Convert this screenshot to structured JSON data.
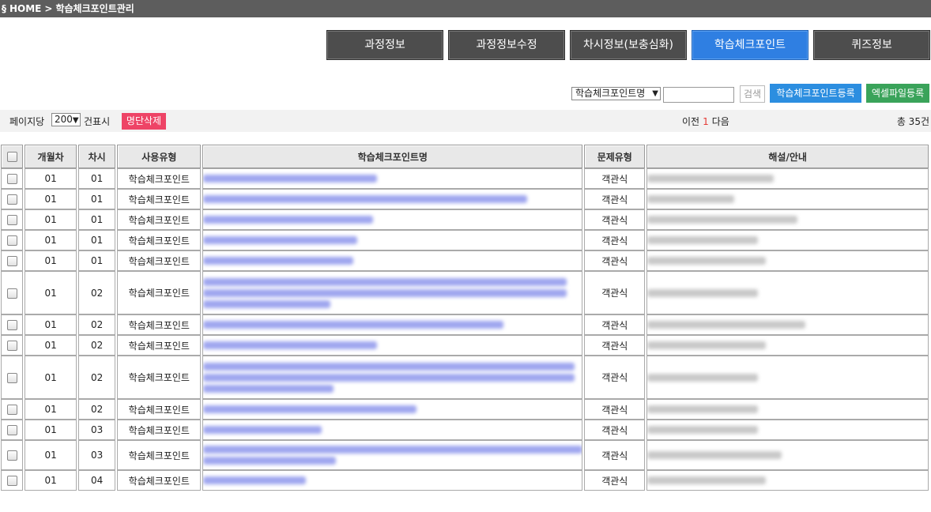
{
  "breadcrumb": {
    "icon": "§",
    "home": "HOME",
    "sep": ">",
    "current": "학습체크포인트관리"
  },
  "tabs": [
    {
      "label": "과정정보",
      "active": false
    },
    {
      "label": "과정정보수정",
      "active": false
    },
    {
      "label": "차시정보(보충심화)",
      "active": false
    },
    {
      "label": "학습체크포인트",
      "active": true
    },
    {
      "label": "퀴즈정보",
      "active": false
    }
  ],
  "search": {
    "field_select": "학습체크포인트명",
    "input_value": "",
    "search_label": "검색",
    "register_label": "학습체크포인트등록",
    "excel_label": "엑셀파일등록"
  },
  "toolbar": {
    "per_page_label": "페이지당",
    "per_page_value": "200",
    "per_page_unit": "건표시",
    "delete_label": "명단삭제",
    "prev_label": "이전",
    "current_page": "1",
    "next_label": "다음",
    "total_label": "총 35건"
  },
  "table": {
    "headers": [
      "",
      "개월차",
      "차시",
      "사용유형",
      "학습체크포인트명",
      "문제유형",
      "해설/안내"
    ],
    "rows": [
      {
        "month": "01",
        "lesson": "01",
        "use_type": "학습체크포인트",
        "question_type": "객관식",
        "title_lines": 1,
        "expl_lines": 1
      },
      {
        "month": "01",
        "lesson": "01",
        "use_type": "학습체크포인트",
        "question_type": "객관식",
        "title_lines": 1,
        "expl_lines": 1
      },
      {
        "month": "01",
        "lesson": "01",
        "use_type": "학습체크포인트",
        "question_type": "객관식",
        "title_lines": 1,
        "expl_lines": 1
      },
      {
        "month": "01",
        "lesson": "01",
        "use_type": "학습체크포인트",
        "question_type": "객관식",
        "title_lines": 1,
        "expl_lines": 1
      },
      {
        "month": "01",
        "lesson": "01",
        "use_type": "학습체크포인트",
        "question_type": "객관식",
        "title_lines": 1,
        "expl_lines": 1
      },
      {
        "month": "01",
        "lesson": "02",
        "use_type": "학습체크포인트",
        "question_type": "객관식",
        "title_lines": 3,
        "expl_lines": 1
      },
      {
        "month": "01",
        "lesson": "02",
        "use_type": "학습체크포인트",
        "question_type": "객관식",
        "title_lines": 1,
        "expl_lines": 1
      },
      {
        "month": "01",
        "lesson": "02",
        "use_type": "학습체크포인트",
        "question_type": "객관식",
        "title_lines": 1,
        "expl_lines": 1
      },
      {
        "month": "01",
        "lesson": "02",
        "use_type": "학습체크포인트",
        "question_type": "객관식",
        "title_lines": 3,
        "expl_lines": 1
      },
      {
        "month": "01",
        "lesson": "02",
        "use_type": "학습체크포인트",
        "question_type": "객관식",
        "title_lines": 1,
        "expl_lines": 1
      },
      {
        "month": "01",
        "lesson": "03",
        "use_type": "학습체크포인트",
        "question_type": "객관식",
        "title_lines": 1,
        "expl_lines": 1
      },
      {
        "month": "01",
        "lesson": "03",
        "use_type": "학습체크포인트",
        "question_type": "객관식",
        "title_lines": 2,
        "expl_lines": 1
      },
      {
        "month": "01",
        "lesson": "04",
        "use_type": "학습체크포인트",
        "question_type": "객관식",
        "title_lines": 1,
        "expl_lines": 1
      }
    ]
  },
  "colors": {
    "breadcrumb_bg": "#5d5d5d",
    "tab_bg": "#4d4d4d",
    "tab_active": "#2f7fe2",
    "register_btn": "#2c8ee0",
    "excel_btn": "#3aa35a",
    "delete_btn": "#ee4466"
  }
}
